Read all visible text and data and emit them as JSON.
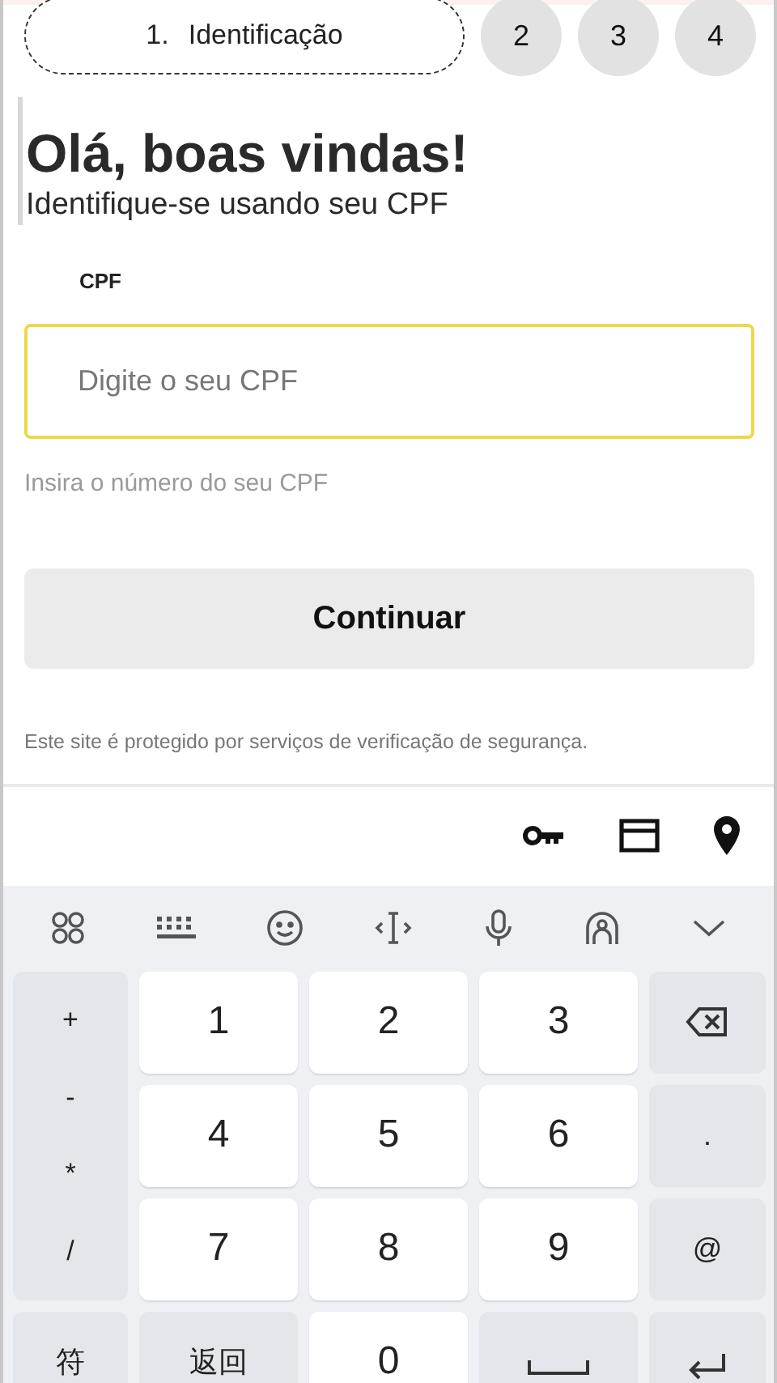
{
  "steps": [
    {
      "number": "1.",
      "label": "Identificação",
      "selected": true
    },
    {
      "number": "2",
      "selected": false
    },
    {
      "number": "3",
      "selected": false
    },
    {
      "number": "4",
      "selected": false
    }
  ],
  "heading": "Olá, boas vindas!",
  "subtitle": "Identifique-se usando seu CPF",
  "cpf_field": {
    "label": "CPF",
    "placeholder": "Digite o seu CPF",
    "focused": true,
    "helper": "Insira o número do seu CPF"
  },
  "continue_button": "Continuar",
  "footer_note": "Este site é protegido por serviços de verificação de segurança.",
  "autofill_bar": {
    "icons": [
      {
        "kind": "key"
      },
      {
        "kind": "card"
      },
      {
        "kind": "location"
      }
    ]
  },
  "keyboard": {
    "toolbar": [
      {
        "kind": "apps"
      },
      {
        "kind": "keyboard"
      },
      {
        "kind": "emoji"
      },
      {
        "kind": "cursor"
      },
      {
        "kind": "mic"
      },
      {
        "kind": "assistant"
      },
      {
        "kind": "collapse"
      }
    ],
    "keys": [
      {
        "kind": "symbols",
        "labels": [
          "+",
          "-",
          "*",
          "/"
        ]
      },
      {
        "kind": "digit",
        "label": "1"
      },
      {
        "kind": "digit",
        "label": "2"
      },
      {
        "kind": "digit",
        "label": "3"
      },
      {
        "kind": "backspace"
      },
      {
        "kind": "digit",
        "label": "4"
      },
      {
        "kind": "digit",
        "label": "5"
      },
      {
        "kind": "digit",
        "label": "6"
      },
      {
        "kind": "function",
        "label": "."
      },
      {
        "kind": "digit",
        "label": "7"
      },
      {
        "kind": "digit",
        "label": "8"
      },
      {
        "kind": "digit",
        "label": "9"
      },
      {
        "kind": "function",
        "label": "@"
      },
      {
        "kind": "function",
        "label": "符"
      },
      {
        "kind": "function",
        "label": "返回"
      },
      {
        "kind": "digit",
        "label": "0"
      },
      {
        "kind": "space"
      },
      {
        "kind": "enter"
      }
    ]
  }
}
